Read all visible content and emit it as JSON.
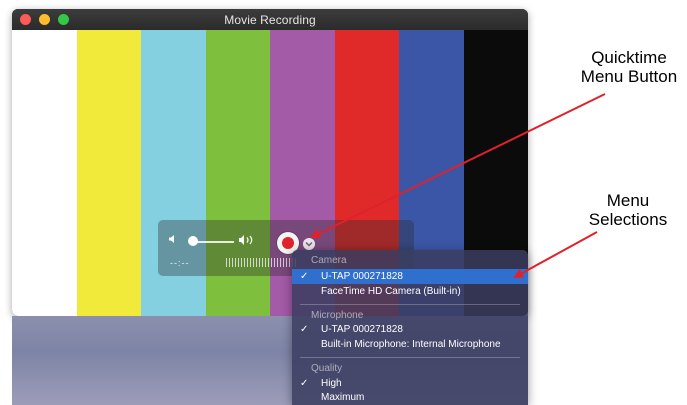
{
  "window": {
    "title": "Movie Recording"
  },
  "colors": {
    "bars": [
      "#ffffff",
      "#f2ea3a",
      "#84d0e0",
      "#7fbf3e",
      "#a35aa7",
      "#e02a2a",
      "#3b56a6",
      "#0b0b0b"
    ],
    "accent": "#e0222c",
    "selection": "#2f6fce",
    "annotation_arrow": "#e0212a"
  },
  "hud": {
    "volume_low_icon": "speaker-low-icon",
    "volume_high_icon": "speaker-high-icon",
    "time": "--:--",
    "record_icon": "record-icon",
    "menu_icon": "chevron-down-icon"
  },
  "menu": {
    "sections": [
      {
        "header": "Camera",
        "items": [
          {
            "label": "U-TAP  000271828",
            "checked": true,
            "selected": true
          },
          {
            "label": "FaceTime HD Camera (Built-in)",
            "checked": false,
            "selected": false
          }
        ]
      },
      {
        "header": "Microphone",
        "items": [
          {
            "label": "U-TAP  000271828",
            "checked": true,
            "selected": false
          },
          {
            "label": "Built-in Microphone: Internal Microphone",
            "checked": false,
            "selected": false
          }
        ]
      },
      {
        "header": "Quality",
        "items": [
          {
            "label": "High",
            "checked": true,
            "selected": false
          },
          {
            "label": "Maximum",
            "checked": false,
            "selected": false
          }
        ]
      }
    ],
    "check_mark": "✓"
  },
  "annotations": {
    "quicktime_line1": "Quicktime",
    "quicktime_line2": "Menu Button",
    "menu_line1": "Menu",
    "menu_line2": "Selections"
  }
}
